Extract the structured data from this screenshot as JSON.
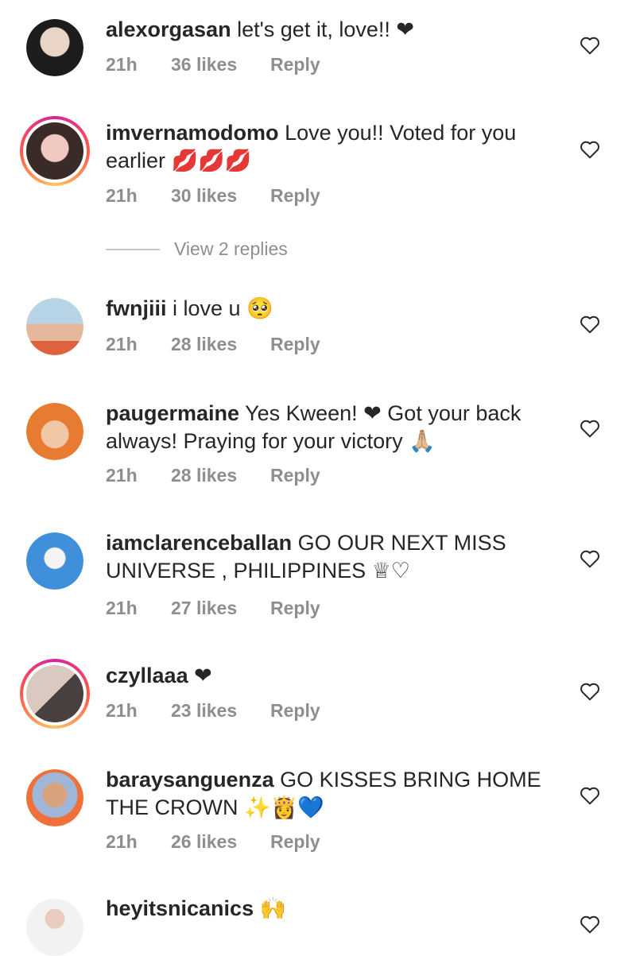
{
  "comments": [
    {
      "username": "alexorgasan",
      "text": "let's get it, love!! ❤",
      "time": "21h",
      "likes": "36 likes",
      "reply": "Reply"
    },
    {
      "username": "imvernamodomo",
      "text": "Love you!! Voted for you earlier 💋💋💋",
      "time": "21h",
      "likes": "30 likes",
      "reply": "Reply",
      "view_replies": "View 2 replies"
    },
    {
      "username": "fwnjiii",
      "text": "i love u 🥺",
      "time": "21h",
      "likes": "28 likes",
      "reply": "Reply"
    },
    {
      "username": "paugermaine",
      "text": "Yes Kween! ❤ Got your back always! Praying for your victory 🙏🏼",
      "time": "21h",
      "likes": "28 likes",
      "reply": "Reply"
    },
    {
      "username": "iamclarenceballan",
      "text": "GO OUR NEXT MISS UNIVERSE , PHILIPPINES ♕♡",
      "time": "21h",
      "likes": "27 likes",
      "reply": "Reply"
    },
    {
      "username": "czyllaaa",
      "text": "❤",
      "time": "21h",
      "likes": "23 likes",
      "reply": "Reply"
    },
    {
      "username": "baraysanguenza",
      "text": "GO KISSES BRING HOME THE CROWN ✨👸💙",
      "time": "21h",
      "likes": "26 likes",
      "reply": "Reply"
    },
    {
      "username": "heyitsnicanics",
      "text": "🙌",
      "time": "",
      "likes": "",
      "reply": ""
    }
  ],
  "colors": {
    "text": "#262626",
    "meta": "#8e8e8e",
    "heart_red": "#ed4956"
  },
  "icons": {
    "like": "heart-outline-icon"
  }
}
